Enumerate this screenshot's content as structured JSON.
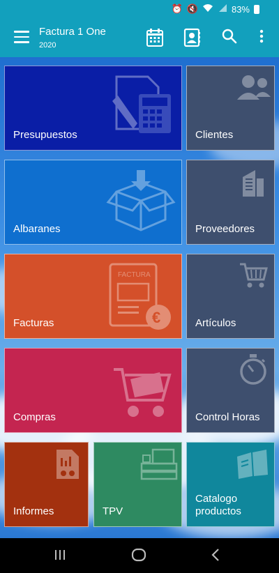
{
  "status": {
    "battery": "83%"
  },
  "appbar": {
    "title": "Factura 1 One",
    "subtitle": "2020",
    "icons": [
      "menu-icon",
      "calendar-icon",
      "contacts-icon",
      "search-icon",
      "more-vert-icon"
    ]
  },
  "tiles": {
    "presupuestos": {
      "label": "Presupuestos",
      "color": "#0a1ea6"
    },
    "clientes": {
      "label": "Clientes",
      "color": "#3e4f6e"
    },
    "albaranes": {
      "label": "Albaranes",
      "color": "#0f6fcf"
    },
    "proveedores": {
      "label": "Proveedores",
      "color": "#3e4f6e"
    },
    "facturas": {
      "label": "Facturas",
      "color": "#d4502a"
    },
    "articulos": {
      "label": "Artículos",
      "color": "#3e4f6e"
    },
    "compras": {
      "label": "Compras",
      "color": "#c42550"
    },
    "control_horas": {
      "label": "Control Horas",
      "color": "#3e4f6e"
    },
    "informes": {
      "label": "Informes",
      "color": "#a3310f"
    },
    "tpv": {
      "label": "TPV",
      "color": "#2e8a61"
    },
    "catalogo": {
      "label": "Catalogo\nproductos",
      "color": "#10879c"
    }
  },
  "invoice_icon_text": "FACTURA",
  "navbar": {
    "icons": [
      "recent-apps-icon",
      "home-icon",
      "back-icon"
    ]
  }
}
